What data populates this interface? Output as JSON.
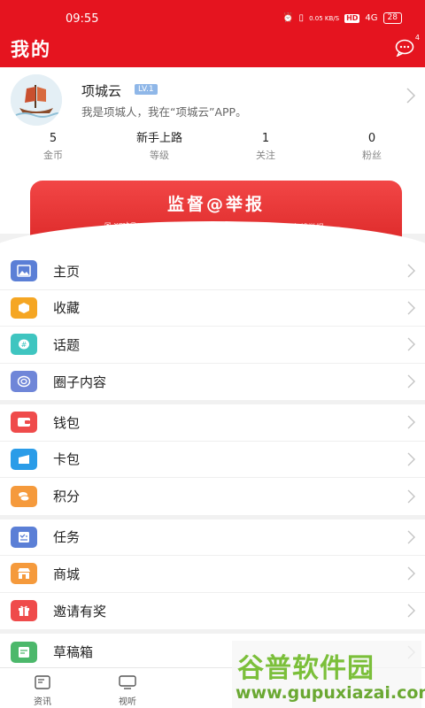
{
  "status_bar": {
    "time": "09:55",
    "speed": "0.05 KB/S",
    "hd": "HD",
    "network": "4G",
    "battery": "28"
  },
  "header": {
    "title": "我的",
    "message_badge": "4"
  },
  "profile": {
    "name": "项城云",
    "level": "LV.1",
    "bio": "我是项城人，我在“项城云”APP。",
    "stats": [
      {
        "value": "5",
        "label": "金币"
      },
      {
        "value": "新手上路",
        "label": "等级"
      },
      {
        "value": "1",
        "label": "关注"
      },
      {
        "value": "0",
        "label": "粉丝"
      }
    ]
  },
  "banner": {
    "title": "监督@举报",
    "email": "✉ xmt@xcyun.net",
    "link": "☐ 或点击进入在线举报"
  },
  "menu": {
    "groups": [
      [
        {
          "label": "主页",
          "icon": "image-icon",
          "color": "#5b7fd6"
        },
        {
          "label": "收藏",
          "icon": "box-icon",
          "color": "#f5a623"
        },
        {
          "label": "话题",
          "icon": "hashtag-icon",
          "color": "#3fc5c0"
        },
        {
          "label": "圈子内容",
          "icon": "circle-icon",
          "color": "#6f86d8"
        }
      ],
      [
        {
          "label": "钱包",
          "icon": "wallet-icon",
          "color": "#ef4b4b"
        },
        {
          "label": "卡包",
          "icon": "card-icon",
          "color": "#2a9ce8"
        },
        {
          "label": "积分",
          "icon": "coins-icon",
          "color": "#f59a3c"
        }
      ],
      [
        {
          "label": "任务",
          "icon": "task-icon",
          "color": "#5b7fd6"
        },
        {
          "label": "商城",
          "icon": "store-icon",
          "color": "#f59a3c"
        },
        {
          "label": "邀请有奖",
          "icon": "gift-icon",
          "color": "#ef4b4b"
        }
      ],
      [
        {
          "label": "草稿箱",
          "icon": "draft-icon",
          "color": "#4cb86b"
        }
      ]
    ]
  },
  "bottom_nav": [
    {
      "label": "资讯",
      "icon": "news-icon"
    },
    {
      "label": "视听",
      "icon": "tv-icon"
    }
  ],
  "watermark": {
    "title": "谷普软件园",
    "url": "www.gupuxiazai.com"
  }
}
